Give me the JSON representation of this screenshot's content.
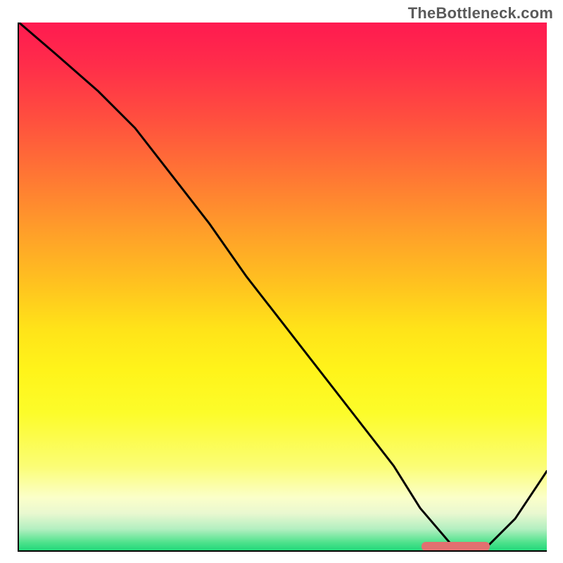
{
  "watermark": "TheBottleneck.com",
  "chart_data": {
    "type": "line",
    "title": "",
    "xlabel": "",
    "ylabel": "",
    "xlim": [
      0,
      100
    ],
    "ylim": [
      0,
      100
    ],
    "series": [
      {
        "name": "curve",
        "x": [
          0,
          7,
          15,
          22,
          29,
          36,
          43,
          50,
          57,
          64,
          71,
          76,
          82,
          88,
          94,
          100
        ],
        "y": [
          100,
          94,
          87,
          80,
          71,
          62,
          52,
          43,
          34,
          25,
          16,
          8,
          1,
          0,
          6,
          15
        ]
      }
    ],
    "marker": {
      "x_start": 76,
      "x_end": 89,
      "y": 0.6,
      "color": "#e27070"
    }
  }
}
